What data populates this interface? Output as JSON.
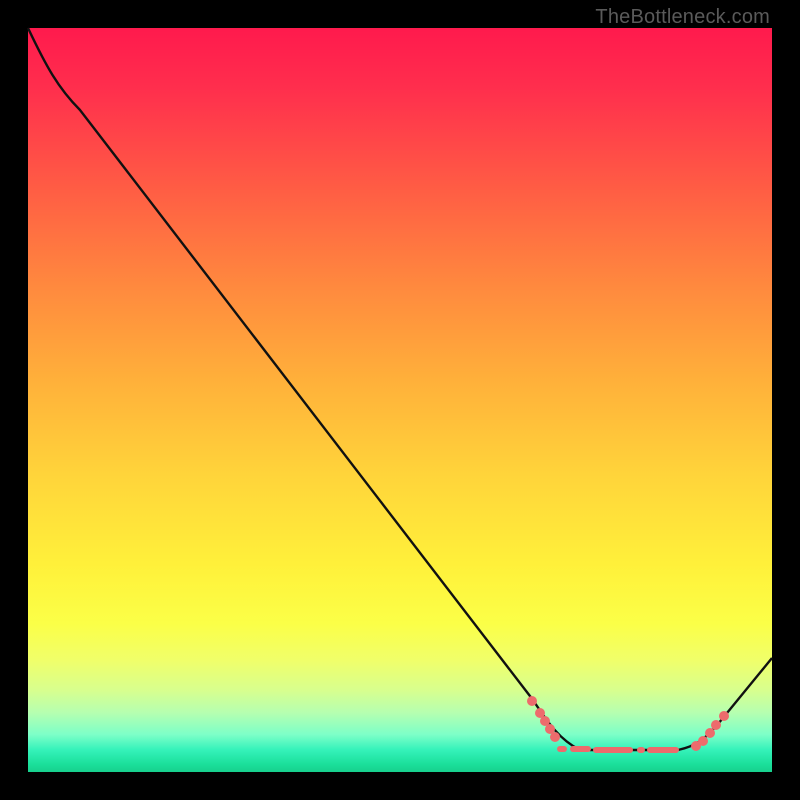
{
  "watermark": "TheBottleneck.com",
  "chart_data": {
    "type": "line",
    "title": "",
    "xlabel": "",
    "ylabel": "",
    "xlim": [
      0,
      100
    ],
    "ylim": [
      0,
      100
    ],
    "background_gradient_meaning": "top=high bottleneck (red), bottom=low bottleneck (green)",
    "series": [
      {
        "name": "bottleneck-curve",
        "x": [
          0,
          3,
          7,
          68,
          72,
          74,
          80,
          87,
          90,
          93,
          100
        ],
        "y": [
          100,
          95,
          89,
          10,
          5,
          3,
          3,
          3,
          4,
          7,
          15
        ],
        "note": "values estimated from pixel positions; no axis tick labels visible"
      }
    ],
    "markers": {
      "name": "highlighted-points",
      "color": "#ed6b6c",
      "x": [
        68,
        69,
        70,
        70.5,
        71,
        74,
        76,
        79,
        83,
        87,
        90,
        91,
        92,
        93,
        94
      ],
      "y": [
        10,
        8,
        7,
        6,
        5,
        3,
        3,
        3,
        3,
        3,
        4,
        5,
        6,
        7,
        8
      ]
    },
    "annotations": [
      {
        "text": "TheBottleneck.com",
        "position": "top-right",
        "role": "watermark"
      }
    ]
  }
}
